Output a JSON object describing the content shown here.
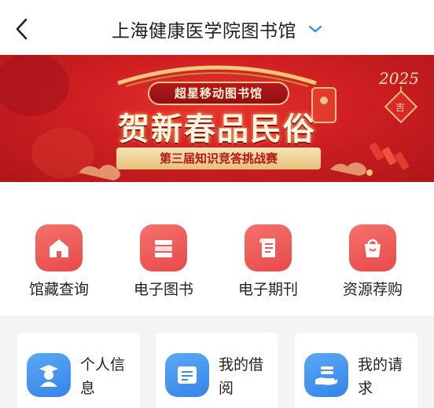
{
  "header": {
    "back_icon": "chevron-left-icon",
    "title": "上海健康医学院图书馆",
    "title_dropdown_icon": "chevron-down-icon"
  },
  "banner": {
    "tag": "超星移动图书馆",
    "headline": "贺新春品民俗",
    "subtitle": "第三届知识竞答挑战赛",
    "year": "2025"
  },
  "menu": {
    "items": [
      {
        "label": "馆藏查询",
        "icon": "home-icon"
      },
      {
        "label": "电子图书",
        "icon": "books-icon"
      },
      {
        "label": "电子期刊",
        "icon": "scroll-document-icon"
      },
      {
        "label": "资源荐购",
        "icon": "shopping-bag-icon"
      }
    ]
  },
  "cards": {
    "items": [
      {
        "label": "个人信息",
        "icon": "graduate-user-icon"
      },
      {
        "label": "我的借阅",
        "icon": "open-book-icon"
      },
      {
        "label": "我的请求",
        "icon": "hand-request-icon"
      }
    ]
  },
  "colors": {
    "menu_icon_bg": "#eb5654",
    "card_icon_bg": "#4597ee",
    "banner_red": "#cf1f22",
    "title_chevron": "#3a8ee6"
  }
}
